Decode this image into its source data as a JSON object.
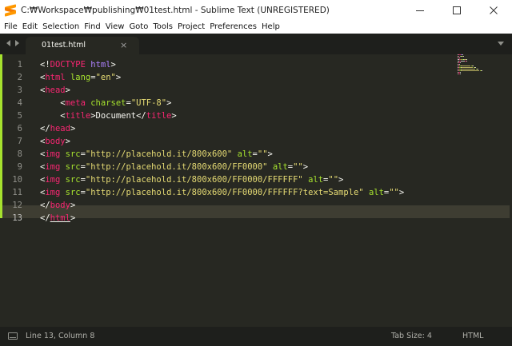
{
  "window": {
    "title": "C:₩Workspace₩publishing₩01test.html - Sublime Text (UNREGISTERED)"
  },
  "menu": [
    "File",
    "Edit",
    "Selection",
    "Find",
    "View",
    "Goto",
    "Tools",
    "Project",
    "Preferences",
    "Help"
  ],
  "tab": {
    "label": "01test.html",
    "close": "×"
  },
  "editor": {
    "current_line": 13,
    "line_numbers": [
      "1",
      "2",
      "3",
      "4",
      "5",
      "6",
      "7",
      "8",
      "9",
      "10",
      "11",
      "12",
      "13"
    ],
    "lines": [
      [
        [
          "t-txt",
          "<!"
        ],
        [
          "t-doc",
          "DOCTYPE"
        ],
        [
          "t-txt",
          " "
        ],
        [
          "t-kw",
          "html"
        ],
        [
          "t-txt",
          ">"
        ]
      ],
      [
        [
          "t-txt",
          "<"
        ],
        [
          "t-tag",
          "html"
        ],
        [
          "t-txt",
          " "
        ],
        [
          "t-attr",
          "lang"
        ],
        [
          "t-txt",
          "="
        ],
        [
          "t-str",
          "\"en\""
        ],
        [
          "t-txt",
          ">"
        ]
      ],
      [
        [
          "t-txt",
          "<"
        ],
        [
          "t-tag",
          "head"
        ],
        [
          "t-txt",
          ">"
        ]
      ],
      [
        [
          "t-txt",
          "    <"
        ],
        [
          "t-tag",
          "meta"
        ],
        [
          "t-txt",
          " "
        ],
        [
          "t-attr",
          "charset"
        ],
        [
          "t-txt",
          "="
        ],
        [
          "t-str",
          "\"UTF-8\""
        ],
        [
          "t-txt",
          ">"
        ]
      ],
      [
        [
          "t-txt",
          "    <"
        ],
        [
          "t-tag",
          "title"
        ],
        [
          "t-txt",
          ">Document</"
        ],
        [
          "t-tag",
          "title"
        ],
        [
          "t-txt",
          ">"
        ]
      ],
      [
        [
          "t-txt",
          "</"
        ],
        [
          "t-tag",
          "head"
        ],
        [
          "t-txt",
          ">"
        ]
      ],
      [
        [
          "t-txt",
          "<"
        ],
        [
          "t-tag",
          "body"
        ],
        [
          "t-txt",
          ">"
        ]
      ],
      [
        [
          "t-txt",
          "<"
        ],
        [
          "t-tag",
          "img"
        ],
        [
          "t-txt",
          " "
        ],
        [
          "t-attr",
          "src"
        ],
        [
          "t-txt",
          "="
        ],
        [
          "t-str",
          "\"http://placehold.it/800x600\""
        ],
        [
          "t-txt",
          " "
        ],
        [
          "t-attr",
          "alt"
        ],
        [
          "t-txt",
          "="
        ],
        [
          "t-str",
          "\"\""
        ],
        [
          "t-txt",
          ">"
        ]
      ],
      [
        [
          "t-txt",
          "<"
        ],
        [
          "t-tag",
          "img"
        ],
        [
          "t-txt",
          " "
        ],
        [
          "t-attr",
          "src"
        ],
        [
          "t-txt",
          "="
        ],
        [
          "t-str",
          "\"http://placehold.it/800x600/FF0000\""
        ],
        [
          "t-txt",
          " "
        ],
        [
          "t-attr",
          "alt"
        ],
        [
          "t-txt",
          "="
        ],
        [
          "t-str",
          "\"\""
        ],
        [
          "t-txt",
          ">"
        ]
      ],
      [
        [
          "t-txt",
          "<"
        ],
        [
          "t-tag",
          "img"
        ],
        [
          "t-txt",
          " "
        ],
        [
          "t-attr",
          "src"
        ],
        [
          "t-txt",
          "="
        ],
        [
          "t-str",
          "\"http://placehold.it/800x600/FF0000/FFFFFF\""
        ],
        [
          "t-txt",
          " "
        ],
        [
          "t-attr",
          "alt"
        ],
        [
          "t-txt",
          "="
        ],
        [
          "t-str",
          "\"\""
        ],
        [
          "t-txt",
          ">"
        ]
      ],
      [
        [
          "t-txt",
          "<"
        ],
        [
          "t-tag",
          "img"
        ],
        [
          "t-txt",
          " "
        ],
        [
          "t-attr",
          "src"
        ],
        [
          "t-txt",
          "="
        ],
        [
          "t-str",
          "\"http://placehold.it/800x600/FF0000/FFFFFF?text=Sample\""
        ],
        [
          "t-txt",
          " "
        ],
        [
          "t-attr",
          "alt"
        ],
        [
          "t-txt",
          "="
        ],
        [
          "t-str",
          "\"\""
        ],
        [
          "t-txt",
          ">"
        ]
      ],
      [
        [
          "t-txt",
          "</"
        ],
        [
          "t-tag",
          "body"
        ],
        [
          "t-txt",
          ">"
        ]
      ],
      [
        [
          "t-txt",
          "</"
        ],
        [
          "t-tag",
          "html"
        ],
        [
          "t-txt",
          ">"
        ]
      ]
    ]
  },
  "status": {
    "position": "Line 13, Column 8",
    "tab_size": "Tab Size: 4",
    "syntax": "HTML"
  },
  "colors": {
    "background": "#272822",
    "tag": "#f92672",
    "attribute": "#a6e22e",
    "string": "#e6db74",
    "text": "#f8f8f2",
    "keyword": "#ae81ff"
  },
  "icons": {
    "app": "sublime-text-icon",
    "minimize": "minimize-icon",
    "maximize": "maximize-icon",
    "close": "close-icon",
    "nav_back": "nav-left-icon",
    "nav_forward": "nav-right-icon",
    "tab_dropdown": "chevron-down-icon",
    "panel": "panel-toggle-icon"
  }
}
